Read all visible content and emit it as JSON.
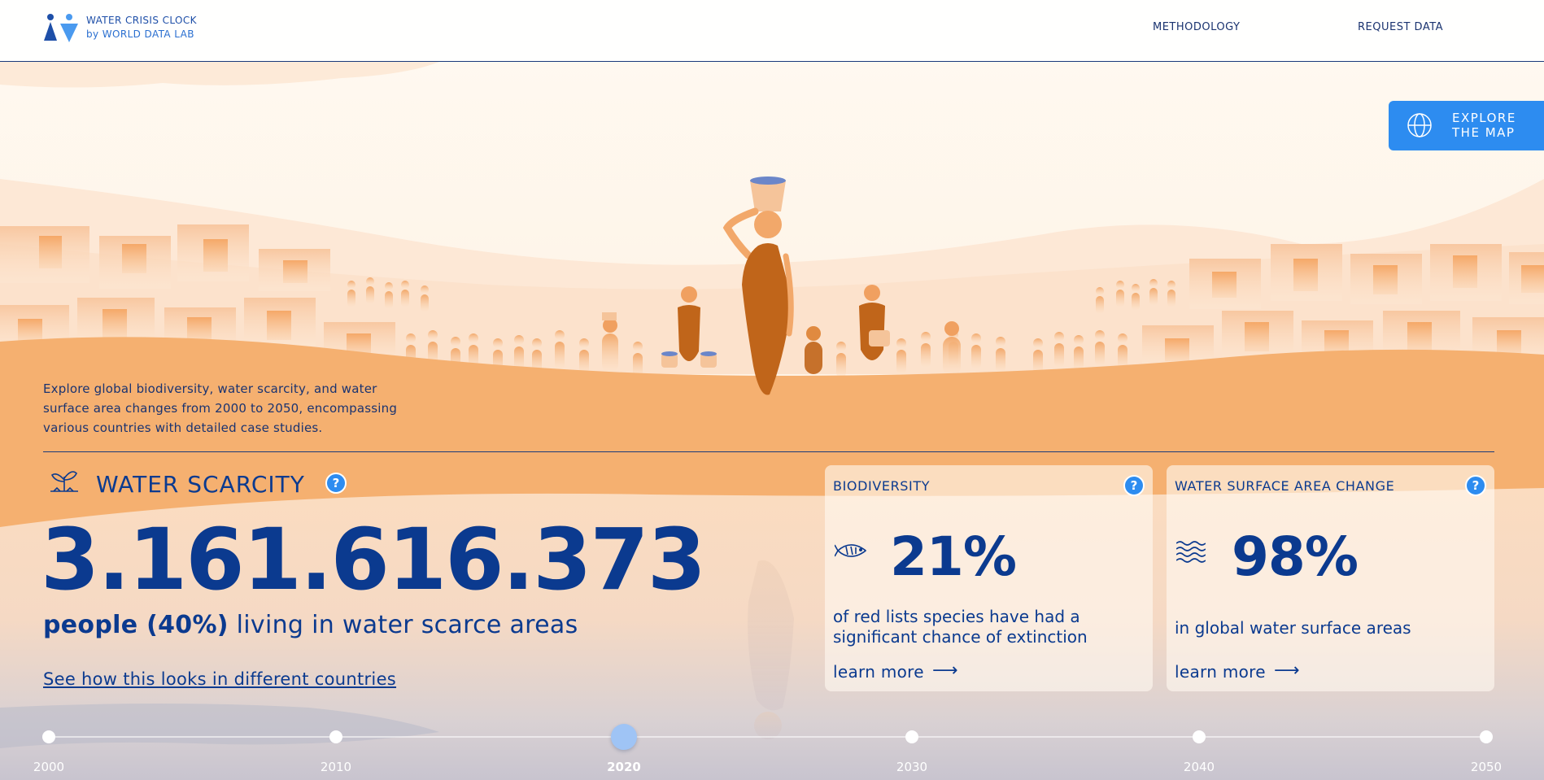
{
  "header": {
    "logo_line1": "WATER CRISIS CLOCK",
    "logo_line2": "by WORLD DATA LAB",
    "nav": {
      "methodology": "METHODOLOGY",
      "request_data": "REQUEST DATA"
    }
  },
  "explore_button": {
    "line1": "EXPLORE",
    "line2": "THE MAP",
    "icon": "globe-icon"
  },
  "intro": {
    "text": "Explore global biodiversity, water scarcity, and water surface area changes from 2000 to 2050, encompassing various countries with detailed case studies."
  },
  "water_scarcity": {
    "title": "WATER SCARCITY",
    "icon": "drought-plant-icon",
    "value": "3.161.616.373",
    "people_bold": "people (40%)",
    "people_rest": " living in water scarce areas",
    "link": "See how this looks in different countries",
    "help": "?"
  },
  "cards": {
    "biodiversity": {
      "title": "BIODIVERSITY",
      "icon": "fish-icon",
      "value": "21%",
      "description": "of red lists species have had a significant chance of extinction",
      "learn_more": "learn more",
      "arrow": "⟶",
      "help": "?"
    },
    "water_surface": {
      "title": "WATER SURFACE AREA CHANGE",
      "icon": "waves-icon",
      "value": "98%",
      "description": "in global water surface areas",
      "learn_more": "learn more",
      "arrow": "⟶",
      "help": "?"
    }
  },
  "timeline": {
    "years": [
      "2000",
      "2010",
      "2020",
      "2030",
      "2040",
      "2050"
    ],
    "selected": "2020"
  },
  "colors": {
    "primary": "#0b3a8f",
    "accent": "#2d8cf0",
    "sand": "#f5b070",
    "figure": "#c0651a"
  }
}
